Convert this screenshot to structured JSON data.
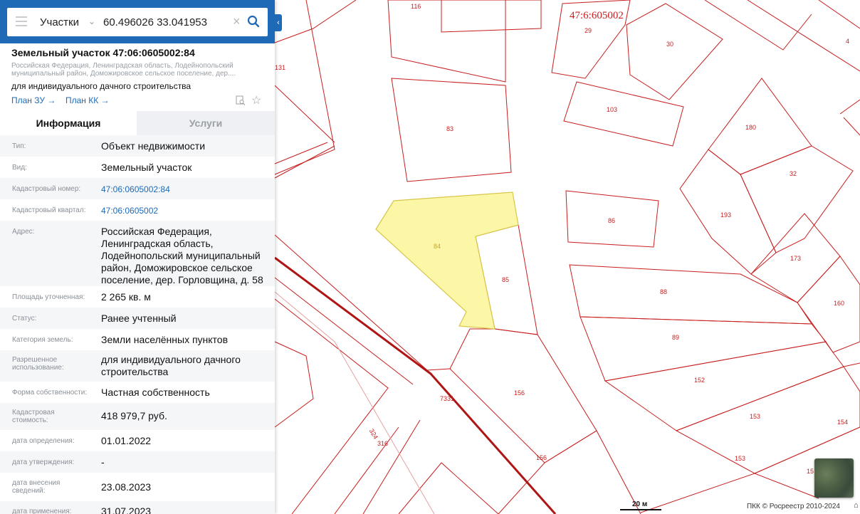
{
  "search": {
    "layer": "Участки",
    "query": "60.496026 33.041953"
  },
  "object": {
    "title": "Земельный участок 47:06:0605002:84",
    "address_short": "Российская Федерация, Ленинградская область, Лодейнопольский муниципальный район, Доможировское сельское поселение, дер....",
    "use": "для индивидуального дачного строительства",
    "plan_zu": "План ЗУ →",
    "plan_kk": "План КК →"
  },
  "tabs": {
    "info": "Информация",
    "services": "Услуги"
  },
  "fields": [
    {
      "label": "Тип:",
      "value": "Объект недвижимости"
    },
    {
      "label": "Вид:",
      "value": "Земельный участок"
    },
    {
      "label": "Кадастровый номер:",
      "value": "47:06:0605002:84"
    },
    {
      "label": "Кадастровый квартал:",
      "value": "47:06:0605002"
    },
    {
      "label": "Адрес:",
      "value": "Российская Федерация, Ленинградская область, Лодейнопольский муниципальный район, Доможировское сельское поселение, дер. Горловщина, д. 58"
    },
    {
      "label": "Площадь уточненная:",
      "value": "2 265 кв. м"
    },
    {
      "label": "Статус:",
      "value": "Ранее учтенный"
    },
    {
      "label": "Категория земель:",
      "value": "Земли населённых пунктов"
    },
    {
      "label": "Разрешенное использование:",
      "value": "для индивидуального дачного строительства"
    },
    {
      "label": "Форма собственности:",
      "value": "Частная собственность"
    },
    {
      "label": "Кадастровая стоимость:",
      "value": "418 979,7 руб."
    },
    {
      "label": "дата определения:",
      "value": "01.01.2022"
    },
    {
      "label": "дата утверждения:",
      "value": "-"
    },
    {
      "label": "дата внесения сведений:",
      "value": "23.08.2023"
    },
    {
      "label": "дата применения:",
      "value": "31.07.2023"
    }
  ],
  "map": {
    "quarter_label": "47:6:605002",
    "parcels": [
      "116",
      "131",
      "83",
      "29",
      "30",
      "4",
      "103",
      "180",
      "32",
      "86",
      "193",
      "84",
      "85",
      "173",
      "88",
      "160",
      "89",
      "152",
      "156",
      "7331",
      "324",
      "316",
      "153",
      "154",
      "15"
    ],
    "scale": "20 м",
    "copyright": "ПКК © Росреестр 2010-2024",
    "colors": {
      "boundary": "#c81e1e",
      "selected_fill": "#fbf7a6",
      "selected_stroke": "#d8c64a",
      "road": "#b01515"
    }
  }
}
